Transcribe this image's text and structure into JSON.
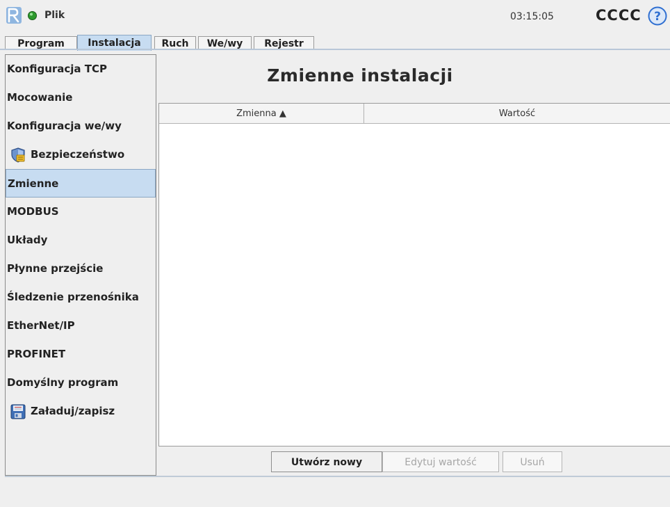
{
  "header": {
    "file_menu": "Plik",
    "clock": "03:15:05",
    "robot_name": "CCCC",
    "help_label": "?"
  },
  "tabs": [
    {
      "label": "Program",
      "active": false
    },
    {
      "label": "Instalacja",
      "active": true
    },
    {
      "label": "Ruch",
      "active": false
    },
    {
      "label": "We/wy",
      "active": false
    },
    {
      "label": "Rejestr",
      "active": false
    }
  ],
  "sidebar": {
    "items": [
      {
        "label": "Konfiguracja TCP",
        "icon": null
      },
      {
        "label": "Mocowanie",
        "icon": null
      },
      {
        "label": "Konfiguracja we/wy",
        "icon": null
      },
      {
        "label": "Bezpieczeństwo",
        "icon": "shield-icon"
      },
      {
        "label": "Zmienne",
        "icon": null,
        "selected": true
      },
      {
        "label": "MODBUS",
        "icon": null
      },
      {
        "label": "Układy",
        "icon": null
      },
      {
        "label": "Płynne przejście",
        "icon": null
      },
      {
        "label": "Śledzenie przenośnika",
        "icon": null
      },
      {
        "label": "EtherNet/IP",
        "icon": null
      },
      {
        "label": "PROFINET",
        "icon": null
      },
      {
        "label": "Domyślny program",
        "icon": null
      },
      {
        "label": "Załaduj/zapisz",
        "icon": "floppy-disk-icon"
      }
    ]
  },
  "main": {
    "title": "Zmienne instalacji",
    "table": {
      "columns": [
        "Zmienna ▲",
        "Wartość"
      ],
      "rows": []
    },
    "buttons": {
      "create": "Utwórz nowy",
      "edit": "Edytuj wartość",
      "delete": "Usuń"
    }
  },
  "colors": {
    "selected_bg": "#c7dcf1",
    "status_ok": "#2e9a2e",
    "help_blue": "#2f6fd1"
  }
}
